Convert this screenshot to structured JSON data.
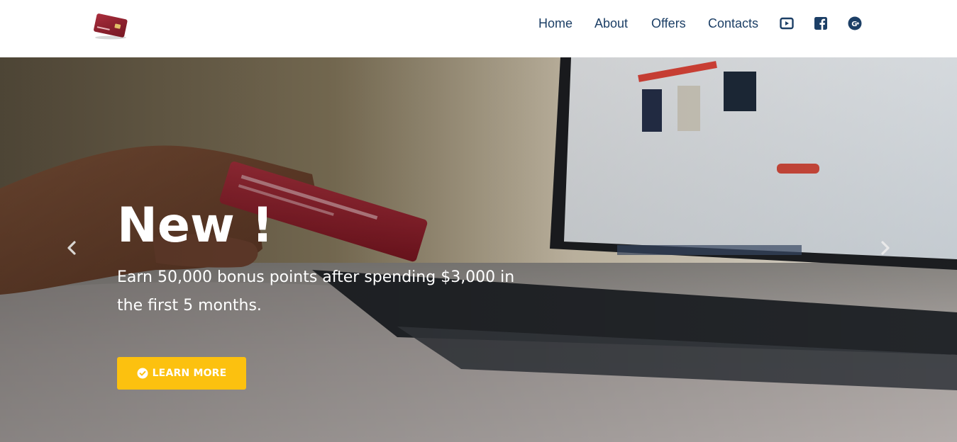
{
  "nav": {
    "links": [
      "Home",
      "About",
      "Offers",
      "Contacts"
    ]
  },
  "social": {
    "icons": [
      "youtube-icon",
      "facebook-icon",
      "google-plus-icon"
    ]
  },
  "hero": {
    "headline": "New !",
    "subtext": "Earn 50,000 bonus points after spending $3,000 in the first 5 months.",
    "cta_label": "LEARN MORE",
    "cta_icon": "check-circle-icon"
  },
  "colors": {
    "nav_text": "#1c3f66",
    "cta_bg": "#fcc10f",
    "hero_text": "#ffffff"
  }
}
